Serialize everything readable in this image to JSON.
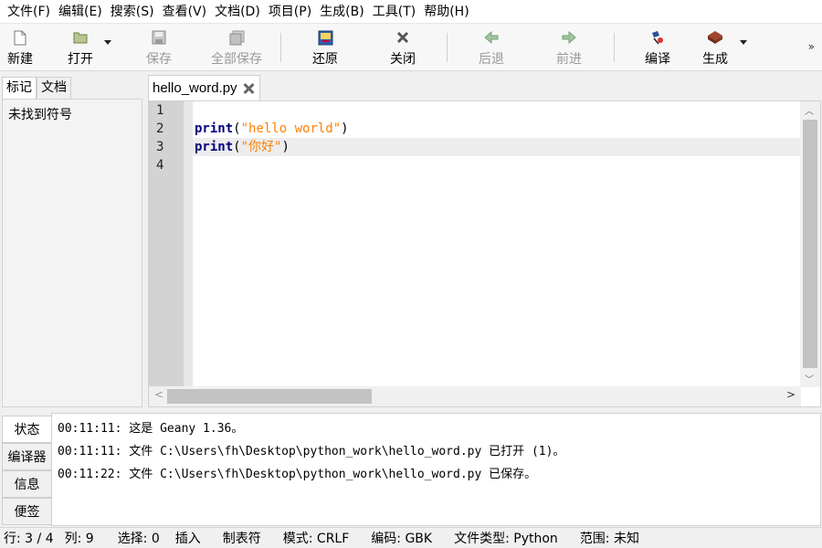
{
  "menu": [
    "文件(F)",
    "编辑(E)",
    "搜索(S)",
    "查看(V)",
    "文档(D)",
    "项目(P)",
    "生成(B)",
    "工具(T)",
    "帮助(H)"
  ],
  "toolbar": {
    "new": "新建",
    "open": "打开",
    "save": "保存",
    "save_all": "全部保存",
    "revert": "还原",
    "close": "关闭",
    "back": "后退",
    "forward": "前进",
    "compile": "编译",
    "build": "生成",
    "more": "»"
  },
  "sidebar": {
    "tabs": [
      "标记",
      "文档"
    ],
    "empty_message": "未找到符号"
  },
  "editor": {
    "tab_title": "hello_word.py",
    "line_numbers": [
      "1",
      "2",
      "3",
      "4"
    ],
    "lines": [
      {
        "kw": "",
        "text": ""
      },
      {
        "kw": "print",
        "open": "(",
        "str": "\"hello world\"",
        "close": ")"
      },
      {
        "kw": "print",
        "open": "(",
        "str": "\"你好\"",
        "close": ")"
      },
      {
        "kw": "",
        "text": ""
      }
    ]
  },
  "messages": {
    "tabs": [
      "状态",
      "编译器",
      "信息",
      "便签"
    ],
    "lines": [
      "00:11:11: 这是 Geany 1.36。",
      "00:11:11: 文件 C:\\Users\\fh\\Desktop\\python_work\\hello_word.py 已打开 (1)。",
      "00:11:22: 文件 C:\\Users\\fh\\Desktop\\python_work\\hello_word.py 已保存。"
    ]
  },
  "status": {
    "line": "行: 3 / 4",
    "col": "列: 9",
    "sel": "选择: 0",
    "insert": "插入",
    "indent": "制表符",
    "mode": "模式: CRLF",
    "encoding": "编码: GBK",
    "filetype": "文件类型: Python",
    "scope": "范围: 未知"
  },
  "colors": {
    "keyword": "#00007f",
    "string": "#ff8000",
    "current_line": "#ededed",
    "gutter": "#d3d3d3"
  }
}
